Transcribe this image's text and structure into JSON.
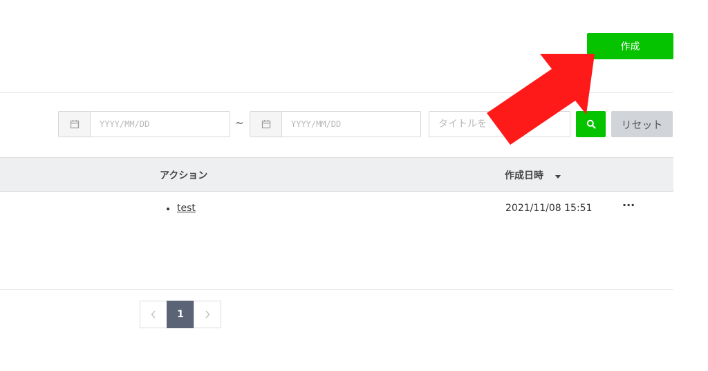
{
  "toolbar": {
    "create_label": "作成"
  },
  "filters": {
    "date_from_placeholder": "YYYY/MM/DD",
    "separator": "~",
    "date_to_placeholder": "YYYY/MM/DD",
    "title_placeholder": "タイトルを",
    "reset_label": "リセット"
  },
  "table": {
    "columns": {
      "action": "アクション",
      "created_at": "作成日時"
    },
    "rows": [
      {
        "action": "test",
        "created_at": "2021/11/08 15:51",
        "menu": "···"
      }
    ]
  },
  "pagination": {
    "current_page": "1"
  },
  "colors": {
    "accent_green": "#06c300",
    "annotation_arrow": "#ff1a1a",
    "pager_active": "#5b6377"
  },
  "icons": [
    "calendar-icon",
    "search-icon",
    "chevron-left-icon",
    "chevron-right-icon",
    "sort-desc-icon",
    "more-icon",
    "annotation-arrow"
  ]
}
